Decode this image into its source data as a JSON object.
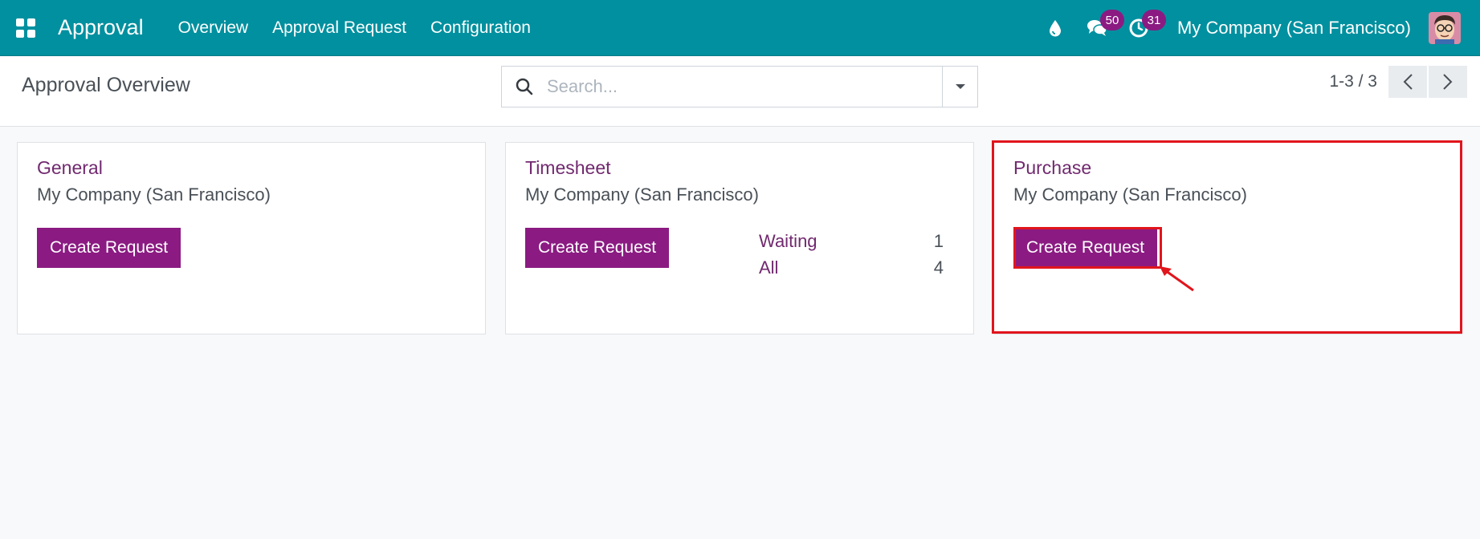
{
  "navbar": {
    "app_title": "Approval",
    "menu": [
      {
        "label": "Overview"
      },
      {
        "label": "Approval Request"
      },
      {
        "label": "Configuration"
      }
    ],
    "messages_count": "50",
    "activities_count": "31",
    "company": "My Company (San Francisco)"
  },
  "control_panel": {
    "title": "Approval Overview",
    "search_placeholder": "Search...",
    "pager": "1-3 / 3"
  },
  "cards": [
    {
      "title": "General",
      "company": "My Company (San Francisco)",
      "button": "Create Request"
    },
    {
      "title": "Timesheet",
      "company": "My Company (San Francisco)",
      "button": "Create Request",
      "stats": [
        {
          "label": "Waiting",
          "count": "1"
        },
        {
          "label": "All",
          "count": "4"
        }
      ]
    },
    {
      "title": "Purchase",
      "company": "My Company (San Francisco)",
      "button": "Create Request"
    }
  ],
  "colors": {
    "navbar": "#00909f",
    "primary": "#8b1b82",
    "annotation": "#e1151c"
  },
  "icons": [
    "apps-grid-icon",
    "water-drop-icon",
    "chat-bubbles-icon",
    "clock-icon",
    "search-icon",
    "caret-down-icon",
    "chevron-left-icon",
    "chevron-right-icon"
  ]
}
